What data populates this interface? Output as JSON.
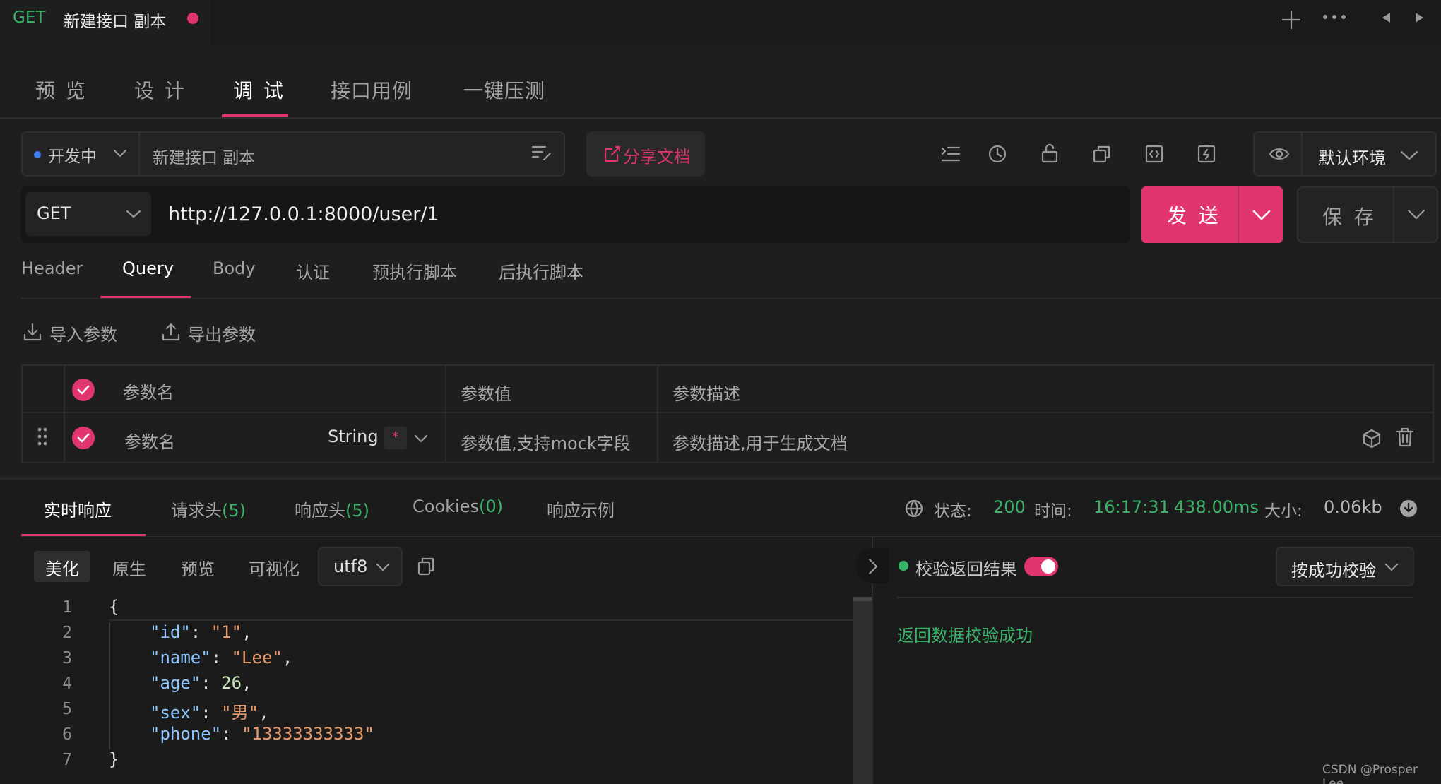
{
  "top_tab": {
    "method": "GET",
    "title": "新建接口 副本"
  },
  "main_tabs": [
    {
      "label": "预 览"
    },
    {
      "label": "设 计"
    },
    {
      "label": "调 试"
    },
    {
      "label": "接口用例"
    },
    {
      "label": "一键压测"
    }
  ],
  "toolbar": {
    "status": "开发中",
    "name_value": "新建接口 副本",
    "share_label": "分享文档",
    "env_label": "默认环境"
  },
  "request": {
    "method": "GET",
    "url": "http://127.0.0.1:8000/user/1",
    "send_label": "发 送",
    "save_label": "保 存"
  },
  "req_tabs": [
    {
      "label": "Header"
    },
    {
      "label": "Query"
    },
    {
      "label": "Body"
    },
    {
      "label": "认证"
    },
    {
      "label": "预执行脚本"
    },
    {
      "label": "后执行脚本"
    }
  ],
  "params": {
    "import_label": "导入参数",
    "export_label": "导出参数",
    "headers": {
      "name": "参数名",
      "value": "参数值",
      "desc": "参数描述"
    },
    "row": {
      "name_placeholder": "参数名",
      "type": "String",
      "required_mark": "*",
      "value_placeholder": "参数值,支持mock字段",
      "desc_placeholder": "参数描述,用于生成文档"
    }
  },
  "response_tabs": [
    {
      "label": "实时响应"
    },
    {
      "label": "请求头",
      "count": "(5)"
    },
    {
      "label": "响应头",
      "count": "(5)"
    },
    {
      "label": "Cookies",
      "count": "(0)"
    },
    {
      "label": "响应示例"
    }
  ],
  "response_status": {
    "status_label": "状态:",
    "status_value": "200",
    "time_label": "时间:",
    "time_value": "16:17:31",
    "duration": "438.00ms",
    "size_label": "大小:",
    "size_value": "0.06kb"
  },
  "view_modes": [
    {
      "label": "美化"
    },
    {
      "label": "原生"
    },
    {
      "label": "预览"
    },
    {
      "label": "可视化"
    }
  ],
  "encoding": "utf8",
  "code": {
    "line_numbers": [
      "1",
      "2",
      "3",
      "4",
      "5",
      "6",
      "7"
    ],
    "open_brace": "{",
    "close_brace": "}",
    "colon": ": ",
    "comma": ",",
    "fields": [
      {
        "key": "\"id\"",
        "value": "\"1\"",
        "kind": "str"
      },
      {
        "key": "\"name\"",
        "value": "\"Lee\"",
        "kind": "str"
      },
      {
        "key": "\"age\"",
        "value": "26",
        "kind": "num"
      },
      {
        "key": "\"sex\"",
        "value": "\"男\"",
        "kind": "str"
      },
      {
        "key": "\"phone\"",
        "value": "\"13333333333\"",
        "kind": "str"
      }
    ]
  },
  "validation": {
    "label": "校验返回结果",
    "toggle_on": true,
    "mode": "按成功校验",
    "result": "返回数据校验成功"
  },
  "watermark": "CSDN @Prosper Lee",
  "colors": {
    "accent": "#e0356f",
    "success": "#39b36a",
    "background": "#1e1e1f"
  }
}
